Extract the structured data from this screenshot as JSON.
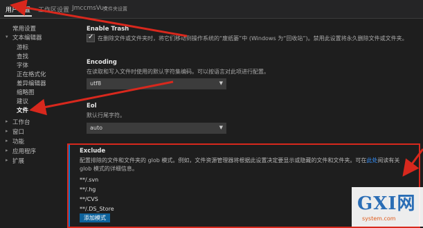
{
  "tabs": [
    {
      "label": "用户设置",
      "active": true
    },
    {
      "label": "工作区设置",
      "active": false
    },
    {
      "label": "JmccmsVue",
      "active": false
    },
    {
      "label": "文件夹设置",
      "active": false
    }
  ],
  "sidebar": {
    "common": "常用设置",
    "text_editor": "文本编辑器",
    "text_editor_children": [
      "游标",
      "查找",
      "字体",
      "正在格式化",
      "差异编辑器",
      "缩略图",
      "建议",
      "文件"
    ],
    "others": [
      "工作台",
      "窗口",
      "功能",
      "应用程序",
      "扩展"
    ]
  },
  "settings": {
    "enable_trash": {
      "title": "Enable Trash",
      "description": "在删除文件或文件夹时，将它们移动到操作系统的“废纸篓”中 (Windows 为“回收站”)。禁用此设置将永久删除文件或文件夹。",
      "checked": true
    },
    "encoding": {
      "title": "Encoding",
      "description": "在读取和写入文件时使用的默认字符集编码。可以按语言对此项进行配置。",
      "value": "utf8"
    },
    "eol": {
      "title": "Eol",
      "description": "默认行尾字符。",
      "value": "auto"
    },
    "exclude": {
      "title": "Exclude",
      "description_line1_a": "配置排除的文件和文件夹的 glob 模式。例如，文件资源管理器将根据此设置决定要显示或隐藏的文件和文件夹。可在",
      "description_link": "此处",
      "description_line1_b": "阅读有关",
      "description_line2": "glob 模式的详细信息。",
      "patterns": [
        "**/.svn",
        "**/.hg",
        "**/CVS",
        "**/.DS_Store"
      ],
      "add_button": "添加模式"
    }
  },
  "watermark": {
    "logo": "GXI网",
    "url": "system.com"
  },
  "colors": {
    "accent": "#007acc",
    "button": "#0e639c",
    "annotation": "#d8281d",
    "link": "#3794ff"
  }
}
